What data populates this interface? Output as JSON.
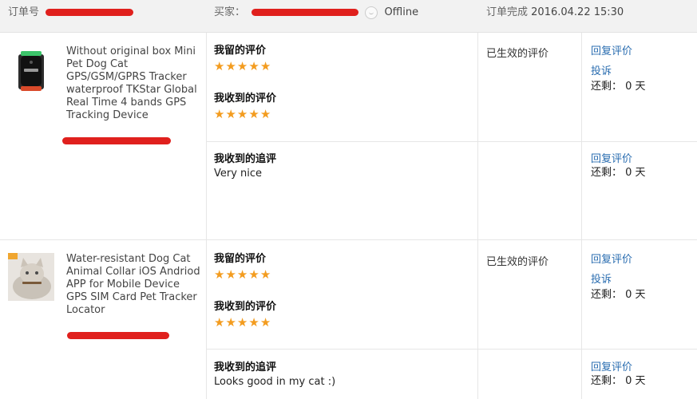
{
  "header": {
    "order_label": "订单号",
    "buyer_label": "买家：",
    "buyer_status": "Offline",
    "order_status": "订单完成",
    "order_date": "2016.04.22 15:30"
  },
  "products": [
    {
      "title": "Without original box Mini Pet Dog Cat GPS/GSM/GPRS Tracker waterproof TKStar Global Real Time 4 bands GPS Tracking Device",
      "thumb_icon": "gps-tracker-device-image",
      "feedback_given_label": "我留的评价",
      "feedback_received_label": "我收到的评价",
      "rating_given": 5,
      "rating_received": 5,
      "status": "已生效的评价",
      "reply_link": "回复评价",
      "complain_link": "投诉",
      "remaining": "还剩： 0 天",
      "followup_label": "我收到的追评",
      "followup_text": "Very nice",
      "followup_reply_link": "回复评价",
      "followup_remaining": "还剩： 0 天"
    },
    {
      "title": "Water-resistant Dog Cat Animal Collar iOS Andriod APP for Mobile Device GPS SIM Card Pet Tracker Locator",
      "thumb_icon": "cat-with-collar-image",
      "feedback_given_label": "我留的评价",
      "feedback_received_label": "我收到的评价",
      "rating_given": 5,
      "rating_received": 5,
      "status": "已生效的评价",
      "reply_link": "回复评价",
      "complain_link": "投诉",
      "remaining": "还剩： 0 天",
      "followup_label": "我收到的追评",
      "followup_text": "Looks good in my cat :)",
      "followup_reply_link": "回复评价",
      "followup_remaining": "还剩： 0 天"
    }
  ],
  "colors": {
    "link": "#2a6db0",
    "star": "#f39c1f",
    "redaction": "#e0201d",
    "header_bg": "#f2f2f2"
  }
}
